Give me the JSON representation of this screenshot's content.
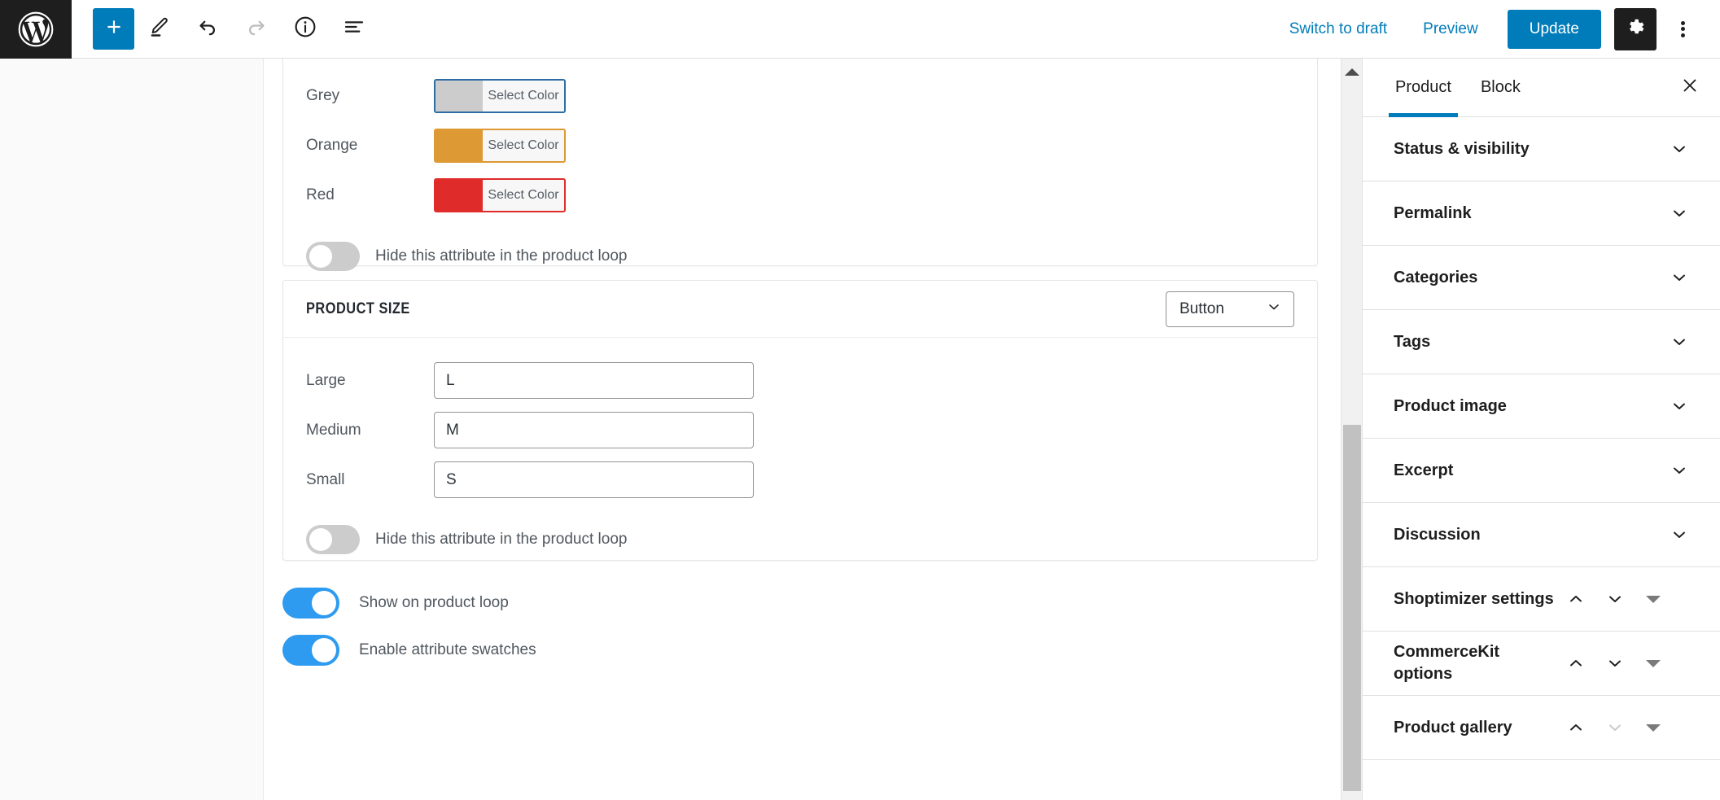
{
  "topbar": {
    "logo_icon": "wordpress-logo-icon",
    "tools": [
      {
        "name": "add-block-button",
        "icon": "plus-icon",
        "label": "+"
      },
      {
        "name": "tools-edit-button",
        "icon": "pencil-icon",
        "label": ""
      },
      {
        "name": "undo-button",
        "icon": "undo-arrow-icon",
        "label": ""
      },
      {
        "name": "redo-button",
        "icon": "redo-arrow-icon",
        "label": ""
      },
      {
        "name": "details-button",
        "icon": "info-circle-icon",
        "label": ""
      },
      {
        "name": "list-view-button",
        "icon": "list-view-icon",
        "label": ""
      }
    ],
    "switch_to_draft": "Switch to draft",
    "preview": "Preview",
    "update": "Update",
    "settings_icon": "gear-icon",
    "options_icon": "kebab-menu-icon",
    "accent_color": "#007cba",
    "dark_color": "#1e1e1e"
  },
  "editor": {
    "color_attribute": {
      "rows": [
        {
          "label": "Grey",
          "button_label": "Select Color",
          "color": "#cccccc",
          "border": "#2e6da4"
        },
        {
          "label": "Orange",
          "button_label": "Select Color",
          "color": "#dd9933",
          "border": "#dd9933"
        },
        {
          "label": "Red",
          "button_label": "Select Color",
          "color": "#e02b2b",
          "border": "#e02b2b"
        }
      ],
      "hide_toggle_label": "Hide this attribute in the product loop",
      "hide_toggle_state": "off"
    },
    "size_attribute": {
      "title": "PRODUCT SIZE",
      "display_type": "Button",
      "rows": [
        {
          "label": "Large",
          "value": "L"
        },
        {
          "label": "Medium",
          "value": "M"
        },
        {
          "label": "Small",
          "value": "S"
        }
      ],
      "hide_toggle_label": "Hide this attribute in the product loop",
      "hide_toggle_state": "off"
    },
    "global_toggles": [
      {
        "label": "Show on product loop",
        "state": "on"
      },
      {
        "label": "Enable attribute swatches",
        "state": "on"
      }
    ],
    "toggle_on_color": "#2e9bf0",
    "toggle_off_color": "#cccccc"
  },
  "sidebar": {
    "tabs": [
      {
        "label": "Product",
        "active": true
      },
      {
        "label": "Block",
        "active": false
      }
    ],
    "close_icon": "close-icon",
    "panels": [
      {
        "label": "Status & visibility",
        "controls": "chevron"
      },
      {
        "label": "Permalink",
        "controls": "chevron"
      },
      {
        "label": "Categories",
        "controls": "chevron"
      },
      {
        "label": "Tags",
        "controls": "chevron"
      },
      {
        "label": "Product image",
        "controls": "chevron"
      },
      {
        "label": "Excerpt",
        "controls": "chevron"
      },
      {
        "label": "Discussion",
        "controls": "chevron"
      },
      {
        "label": "Shoptimizer settings",
        "controls": "meta",
        "up_enabled": true,
        "down_enabled": true
      },
      {
        "label": "CommerceKit options",
        "controls": "meta",
        "up_enabled": true,
        "down_enabled": true
      },
      {
        "label": "Product gallery",
        "controls": "meta",
        "up_enabled": true,
        "down_enabled": false
      }
    ]
  }
}
